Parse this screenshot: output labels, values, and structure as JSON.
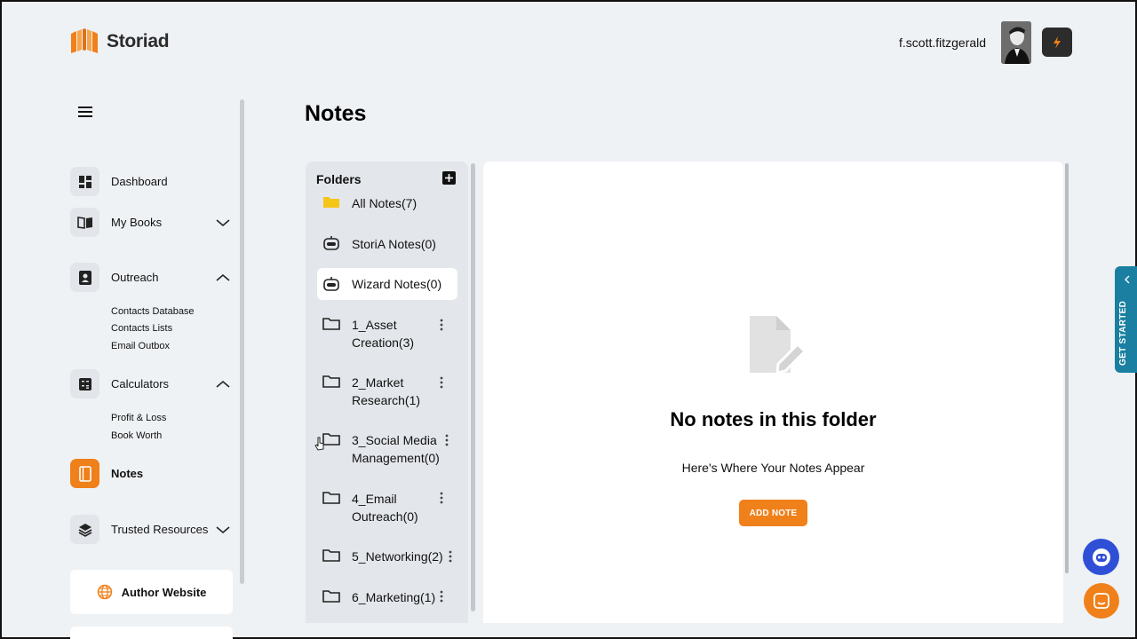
{
  "app": {
    "name": "Storiad"
  },
  "header": {
    "username": "f.scott.fitzgerald"
  },
  "sidebar": {
    "items": [
      {
        "label": "Dashboard"
      },
      {
        "label": "My Books"
      },
      {
        "label": "Outreach",
        "subitems": [
          "Contacts Database",
          "Contacts Lists",
          "Email Outbox"
        ]
      },
      {
        "label": "Calculators",
        "subitems": [
          "Profit & Loss",
          "Book Worth"
        ]
      },
      {
        "label": "Notes"
      },
      {
        "label": "Trusted Resources"
      }
    ],
    "author_website": "Author Website"
  },
  "page": {
    "title": "Notes"
  },
  "folders": {
    "title": "Folders",
    "list": [
      {
        "label": "All Notes(7)"
      },
      {
        "label": "StoriA Notes(0)"
      },
      {
        "label": "Wizard Notes(0)"
      },
      {
        "label": "1_Asset Creation(3)"
      },
      {
        "label": "2_Market Research(1)"
      },
      {
        "label": "3_Social Media Management(0)"
      },
      {
        "label": "4_Email Outreach(0)"
      },
      {
        "label": "5_Networking(2)"
      },
      {
        "label": "6_Marketing(1)"
      }
    ]
  },
  "content": {
    "empty_title": "No notes in this folder",
    "empty_subtitle": "Here's Where Your Notes Appear",
    "add_button": "ADD NOTE"
  },
  "widgets": {
    "get_started": "GET STARTED"
  },
  "colors": {
    "accent": "#f0801a",
    "get_started": "#1a7fa0",
    "bot": "#2f4fd6"
  }
}
